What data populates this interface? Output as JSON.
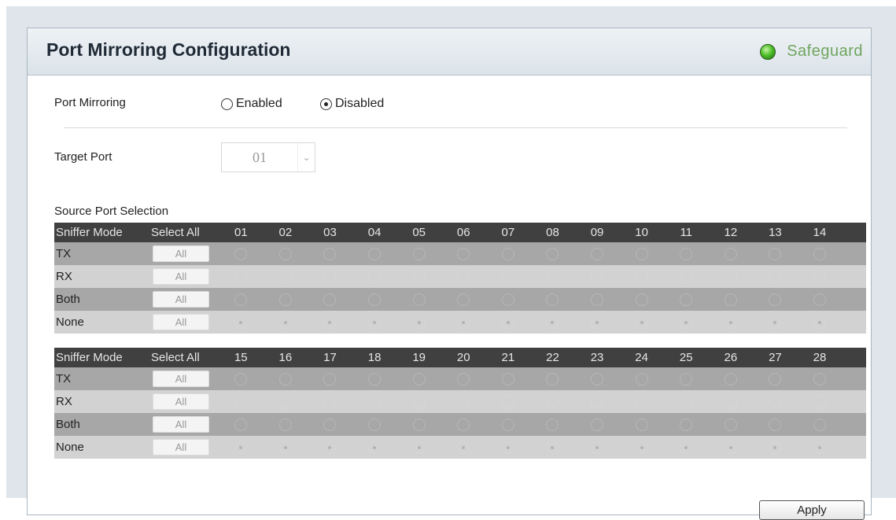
{
  "page": {
    "title": "Port Mirroring Configuration",
    "safeguard_label": "Safeguard",
    "safeguard_color": "#4fc02a"
  },
  "port_mirroring": {
    "label": "Port Mirroring",
    "options": [
      {
        "label": "Enabled",
        "checked": false
      },
      {
        "label": "Disabled",
        "checked": true
      }
    ]
  },
  "target_port": {
    "label": "Target Port",
    "value": "01"
  },
  "source": {
    "label": "Source Port Selection",
    "header_mode": "Sniffer Mode",
    "header_select_all": "Select All",
    "all_label": "All",
    "modes": [
      "TX",
      "RX",
      "Both",
      "None"
    ],
    "group1_ports": [
      "01",
      "02",
      "03",
      "04",
      "05",
      "06",
      "07",
      "08",
      "09",
      "10",
      "11",
      "12",
      "13",
      "14"
    ],
    "group2_ports": [
      "15",
      "16",
      "17",
      "18",
      "19",
      "20",
      "21",
      "22",
      "23",
      "24",
      "25",
      "26",
      "27",
      "28"
    ],
    "selected_mode_index": 3
  },
  "actions": {
    "apply_label": "Apply"
  }
}
